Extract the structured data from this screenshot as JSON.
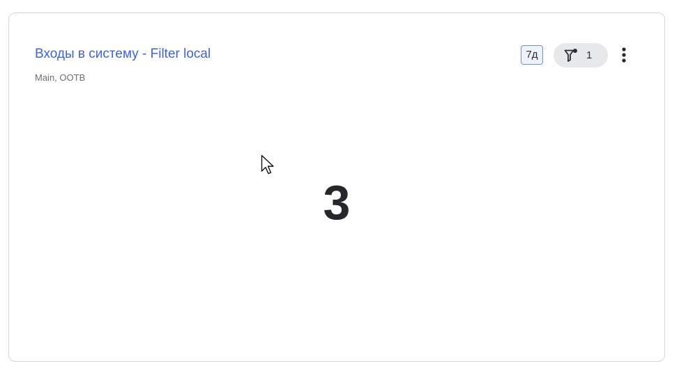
{
  "widget": {
    "title": "Входы в систему  - Filter local",
    "subtitle": "Main, OOTB",
    "period_label": "7д",
    "filter_count": "1",
    "value": "3"
  },
  "icons": {
    "filter": "filter-icon",
    "more": "more-vertical-icon",
    "cursor": "mouse-cursor-icon"
  },
  "colors": {
    "title": "#3f63d6",
    "period_border": "#6f8fe6",
    "chip_bg": "#e6e8eb",
    "value": "#25272b"
  }
}
